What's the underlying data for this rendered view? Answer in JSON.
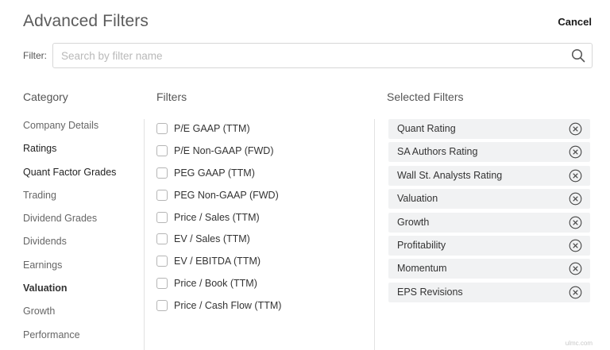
{
  "header": {
    "title": "Advanced Filters",
    "cancel_label": "Cancel"
  },
  "search": {
    "label": "Filter:",
    "placeholder": "Search by filter name",
    "value": ""
  },
  "columns": {
    "category": "Category",
    "filters": "Filters",
    "selected": "Selected Filters"
  },
  "categories": [
    {
      "label": "Company Details"
    },
    {
      "label": "Ratings"
    },
    {
      "label": "Quant Factor Grades"
    },
    {
      "label": "Trading"
    },
    {
      "label": "Dividend Grades"
    },
    {
      "label": "Dividends"
    },
    {
      "label": "Earnings"
    },
    {
      "label": "Valuation"
    },
    {
      "label": "Growth"
    },
    {
      "label": "Performance"
    }
  ],
  "active_category": "Valuation",
  "filters": [
    {
      "label": "P/E GAAP (TTM)",
      "checked": false
    },
    {
      "label": "P/E Non-GAAP (FWD)",
      "checked": false
    },
    {
      "label": "PEG GAAP (TTM)",
      "checked": false
    },
    {
      "label": "PEG Non-GAAP (FWD)",
      "checked": false
    },
    {
      "label": "Price / Sales (TTM)",
      "checked": false
    },
    {
      "label": "EV / Sales (TTM)",
      "checked": false
    },
    {
      "label": "EV / EBITDA (TTM)",
      "checked": false
    },
    {
      "label": "Price / Book (TTM)",
      "checked": false
    },
    {
      "label": "Price / Cash Flow (TTM)",
      "checked": false
    }
  ],
  "selected_filters": [
    {
      "label": "Quant Rating",
      "icon": "remove-circle-icon"
    },
    {
      "label": "SA Authors Rating",
      "icon": "remove-circle-icon"
    },
    {
      "label": "Wall St. Analysts Rating",
      "icon": "remove-circle-icon"
    },
    {
      "label": "Valuation",
      "icon": "remove-circle-icon"
    },
    {
      "label": "Growth",
      "icon": "remove-circle-icon"
    },
    {
      "label": "Profitability",
      "icon": "remove-circle-icon"
    },
    {
      "label": "Momentum",
      "icon": "remove-circle-icon"
    },
    {
      "label": "EPS Revisions",
      "icon": "remove-circle-icon"
    }
  ],
  "watermark": "ulmc.com",
  "colors": {
    "chip_bg": "#f1f2f3",
    "title": "#5b5b5b",
    "border": "#d7d7d7"
  }
}
